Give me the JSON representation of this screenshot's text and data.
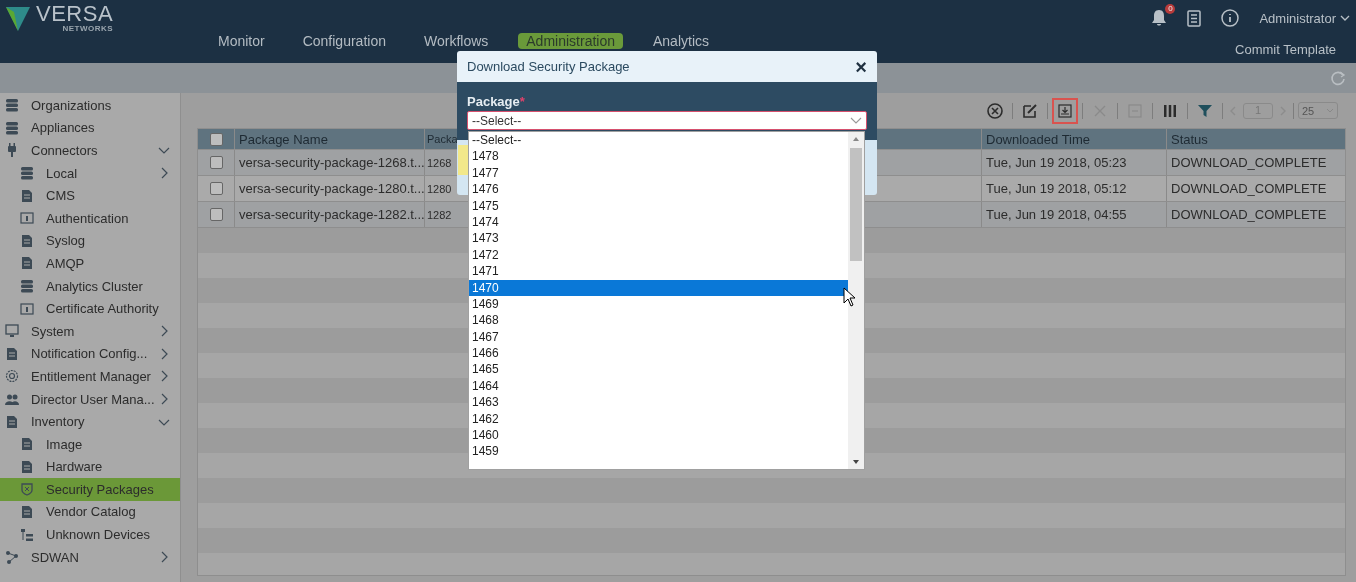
{
  "header": {
    "logo": {
      "name": "VERSA",
      "sub": "NETWORKS"
    },
    "nav": [
      {
        "label": "Monitor",
        "selected": false
      },
      {
        "label": "Configuration",
        "selected": false
      },
      {
        "label": "Workflows",
        "selected": false
      },
      {
        "label": "Administration",
        "selected": true
      },
      {
        "label": "Analytics",
        "selected": false
      }
    ],
    "notification_count": "0",
    "user": "Administrator",
    "commit": "Commit Template"
  },
  "sidebar": {
    "items": [
      {
        "label": "Organizations",
        "selected": false
      },
      {
        "label": "Appliances",
        "selected": false
      },
      {
        "label": "Connectors",
        "selected": false,
        "expanded": true,
        "children": [
          {
            "label": "Local",
            "selected": false,
            "expanded": false
          },
          {
            "label": "CMS",
            "selected": false
          },
          {
            "label": "Authentication",
            "selected": false
          },
          {
            "label": "Syslog",
            "selected": false
          },
          {
            "label": "AMQP",
            "selected": false
          },
          {
            "label": "Analytics Cluster",
            "selected": false
          },
          {
            "label": "Certificate Authority",
            "selected": false
          }
        ]
      },
      {
        "label": "System",
        "selected": false,
        "expanded": false
      },
      {
        "label": "Notification Config...",
        "selected": false,
        "expanded": false
      },
      {
        "label": "Entitlement Manager",
        "selected": false,
        "expanded": false
      },
      {
        "label": "Director User Mana...",
        "selected": false,
        "expanded": false
      },
      {
        "label": "Inventory",
        "selected": false,
        "expanded": true,
        "children": [
          {
            "label": "Image",
            "selected": false
          },
          {
            "label": "Hardware",
            "selected": false
          },
          {
            "label": "Security Packages",
            "selected": true
          },
          {
            "label": "Vendor Catalog",
            "selected": false
          },
          {
            "label": "Unknown Devices",
            "selected": false
          }
        ]
      },
      {
        "label": "SDWAN",
        "selected": false,
        "expanded": false
      }
    ]
  },
  "toolbar": {
    "buttons": [
      {
        "kind": "clear",
        "disabled": false,
        "highlighted": false
      },
      {
        "kind": "edit",
        "disabled": false,
        "highlighted": false
      },
      {
        "kind": "download",
        "disabled": false,
        "highlighted": true
      },
      {
        "kind": "delete",
        "disabled": true,
        "highlighted": false
      },
      {
        "kind": "remove",
        "disabled": true,
        "highlighted": false
      },
      {
        "kind": "columns",
        "disabled": false,
        "highlighted": false
      },
      {
        "kind": "filter",
        "disabled": false,
        "highlighted": false
      }
    ],
    "page": "1",
    "page_size": "25"
  },
  "table": {
    "all_checked": false,
    "columns": [
      "Package Name",
      "Packa",
      "Downloaded Time",
      "Status"
    ],
    "rows": [
      {
        "checked": false,
        "cells": [
          "versa-security-package-1268.t...",
          "1268",
          "Tue, Jun 19 2018, 05:23",
          "DOWNLOAD_COMPLETE"
        ]
      },
      {
        "checked": false,
        "cells": [
          "versa-security-package-1280.t...",
          "1280",
          "Tue, Jun 19 2018, 05:12",
          "DOWNLOAD_COMPLETE"
        ]
      },
      {
        "checked": false,
        "cells": [
          "versa-security-package-1282.t...",
          "1282",
          "Tue, Jun 19 2018, 04:55",
          "DOWNLOAD_COMPLETE"
        ]
      }
    ]
  },
  "dialog": {
    "title": "Download Security Package",
    "close": "×",
    "field": {
      "label": "Package",
      "required_mark": "*",
      "value": "--Select--"
    },
    "options": [
      {
        "label": "--Select--",
        "selected": false
      },
      {
        "label": "1478",
        "selected": false
      },
      {
        "label": "1477",
        "selected": false
      },
      {
        "label": "1476",
        "selected": false
      },
      {
        "label": "1475",
        "selected": false
      },
      {
        "label": "1474",
        "selected": false
      },
      {
        "label": "1473",
        "selected": false
      },
      {
        "label": "1472",
        "selected": false
      },
      {
        "label": "1471",
        "selected": false
      },
      {
        "label": "1470",
        "selected": true
      },
      {
        "label": "1469",
        "selected": false
      },
      {
        "label": "1468",
        "selected": false
      },
      {
        "label": "1467",
        "selected": false
      },
      {
        "label": "1466",
        "selected": false
      },
      {
        "label": "1465",
        "selected": false
      },
      {
        "label": "1464",
        "selected": false
      },
      {
        "label": "1463",
        "selected": false
      },
      {
        "label": "1462",
        "selected": false
      },
      {
        "label": "1460",
        "selected": false
      },
      {
        "label": "1459",
        "selected": false
      }
    ]
  }
}
